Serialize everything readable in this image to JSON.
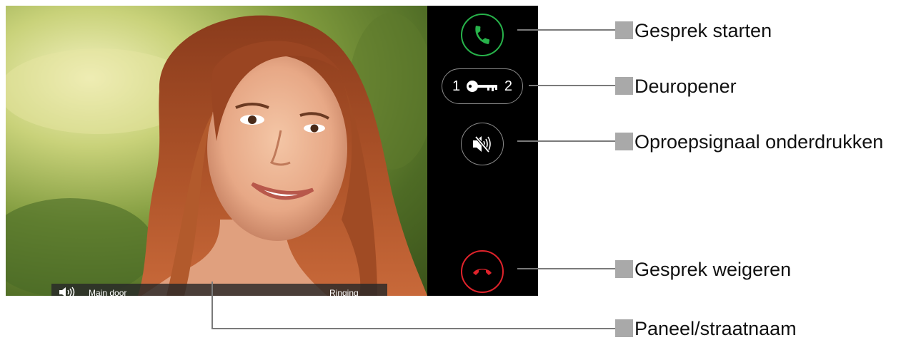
{
  "screen": {
    "status_bar": {
      "door_name": "Main door",
      "call_state": "Ringing"
    },
    "buttons": {
      "door_opener": {
        "left_number": "1",
        "right_number": "2"
      }
    }
  },
  "callouts": {
    "start_call": "Gesprek starten",
    "door_opener": "Deuropener",
    "mute_ringtone": "Oproepsignaal onderdrukken",
    "reject_call": "Gesprek weigeren",
    "panel_name": "Paneel/straatnaam"
  },
  "colors": {
    "accept_green": "#27b24a",
    "reject_red": "#e0232b",
    "panel_bg": "#000000",
    "callout_square": "#a9a9a9",
    "callout_line": "#7a7a7a"
  },
  "icons": [
    "phone-accept-icon",
    "key-icon",
    "speaker-mute-icon",
    "phone-hangup-icon",
    "speaker-icon"
  ]
}
